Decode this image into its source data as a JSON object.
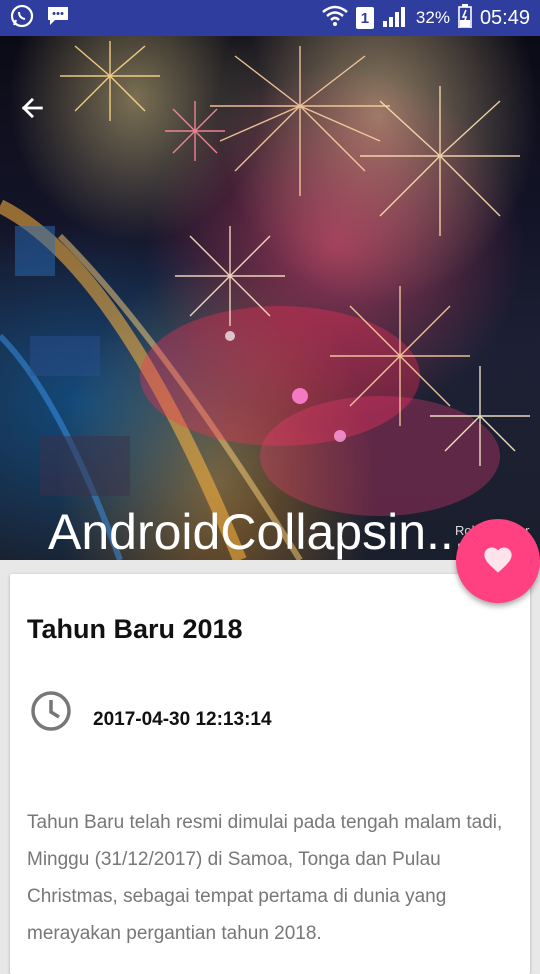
{
  "status_bar": {
    "battery_percent": "32%",
    "time": "05:49",
    "sim_label": "1",
    "icons": [
      "whatsapp-icon",
      "messenger-icon",
      "wifi-icon",
      "sim-icon",
      "signal-icon",
      "battery-icon"
    ]
  },
  "header": {
    "title": "AndroidCollapsin...",
    "watermark": "Rob Whitwor",
    "back_icon": "arrow-left-icon"
  },
  "fab": {
    "icon": "heart-icon",
    "color": "#ff4081"
  },
  "article": {
    "title": "Tahun Baru 2018",
    "date": "2017-04-30 12:13:14",
    "body": "Tahun Baru telah resmi dimulai pada tengah malam tadi, Minggu (31/12/2017) di Samoa, Tonga dan Pulau Christmas, sebagai tempat pertama di dunia yang merayakan pergantian tahun 2018."
  },
  "colors": {
    "status_bar": "#2f3e9e",
    "accent": "#ff4081",
    "body_text": "#777777"
  }
}
